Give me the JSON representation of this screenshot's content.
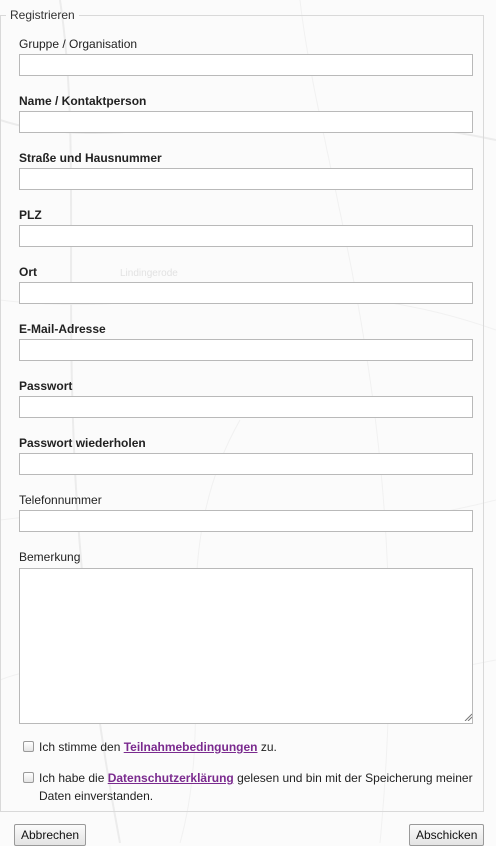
{
  "form": {
    "legend": "Registrieren",
    "fields": [
      {
        "label": "Gruppe / Organisation",
        "value": ""
      },
      {
        "label": "Name / Kontaktperson",
        "value": ""
      },
      {
        "label": "Straße und Hausnummer",
        "value": ""
      },
      {
        "label": "PLZ",
        "value": ""
      },
      {
        "label": "Ort",
        "value": ""
      },
      {
        "label": "E-Mail-Adresse",
        "value": ""
      },
      {
        "label": "Passwort",
        "value": ""
      },
      {
        "label": "Passwort wiederholen",
        "value": ""
      },
      {
        "label": "Telefonnummer",
        "value": ""
      }
    ],
    "remark": {
      "label": "Bemerkung",
      "value": ""
    },
    "consent_terms": {
      "checked": false,
      "text_before": "Ich stimme den ",
      "link": "Teilnahmebedingungen",
      "text_after": " zu."
    },
    "consent_privacy": {
      "checked": false,
      "text_before": "Ich habe die ",
      "link": "Datenschutzerklärung",
      "text_after": " gelesen und bin mit der Speicherung meiner Daten einverstanden."
    },
    "cancel_label": "Abbrechen",
    "submit_label": "Abschicken"
  },
  "map": {
    "place_label": "Lindingerode"
  },
  "colors": {
    "link": "#7a2a8e",
    "border": "#b9b9b9"
  }
}
